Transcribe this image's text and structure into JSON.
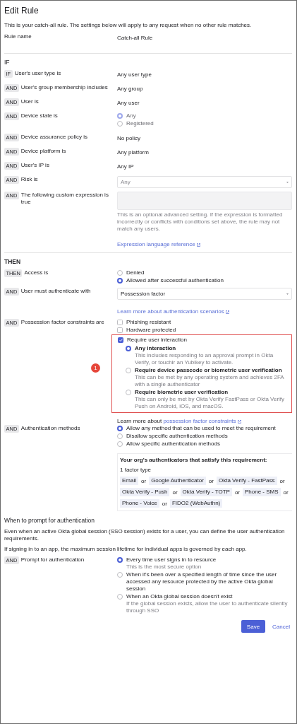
{
  "title": "Edit Rule",
  "intro": "This is your catch-all rule. The settings below will apply to any request when no other rule matches.",
  "rule_name": {
    "label": "Rule name",
    "value": "Catch-all Rule"
  },
  "if_section": {
    "heading": "IF",
    "rows": [
      {
        "badge": "IF",
        "label": "User's user type is",
        "kind": "text",
        "value": "Any user type"
      },
      {
        "badge": "AND",
        "label": "User's group membership includes",
        "kind": "text",
        "value": "Any group"
      },
      {
        "badge": "AND",
        "label": "User is",
        "kind": "text",
        "value": "Any user"
      },
      {
        "badge": "AND",
        "label": "Device state is",
        "kind": "radios",
        "disabled": true,
        "options": [
          {
            "label": "Any",
            "selected": true
          },
          {
            "label": "Registered",
            "selected": false
          }
        ]
      },
      {
        "badge": "AND",
        "label": "Device assurance policy is",
        "kind": "text",
        "value": "No policy"
      },
      {
        "badge": "AND",
        "label": "Device platform is",
        "kind": "text",
        "value": "Any platform"
      },
      {
        "badge": "AND",
        "label": "User's IP is",
        "kind": "text",
        "value": "Any IP"
      },
      {
        "badge": "AND",
        "label": "Risk is",
        "kind": "select",
        "disabled": true,
        "value": "Any"
      },
      {
        "badge": "AND",
        "label": "The following custom expression is true",
        "kind": "textarea",
        "disabled": true,
        "help": "This is an optional advanced setting. If the expression is formatted incorrectly or conflicts with conditions set above, the rule may not match any users.",
        "link": "Expression language reference"
      }
    ]
  },
  "then_section": {
    "heading": "THEN",
    "rows": [
      {
        "badge": "THEN",
        "label": "Access is",
        "kind": "radios",
        "options": [
          {
            "label": "Denied",
            "selected": false
          },
          {
            "label": "Allowed after successful authentication",
            "selected": true
          }
        ]
      },
      {
        "badge": "AND",
        "label": "User must authenticate with",
        "kind": "select",
        "disabled": false,
        "value": "Possession factor",
        "link": "Learn more about authentication scenarios"
      },
      {
        "badge": "AND",
        "label": "Possession factor constraints are",
        "kind": "constraints",
        "callout": "1",
        "checks": [
          {
            "label": "Phishing resistant",
            "checked": false,
            "highlighted": false
          },
          {
            "label": "Hardware protected",
            "checked": false,
            "highlighted": false
          },
          {
            "label": "Require user interaction",
            "checked": true,
            "highlighted": true,
            "options": [
              {
                "label": "Any interaction",
                "description": "This includes responding to an approval prompt in Okta Verify, or touchir an Yubikey to activate.",
                "selected": true
              },
              {
                "label": "Require device passcode or biometric user verification",
                "description": "This can be met by any operating system and achieves 2FA with a single authenticator",
                "selected": false
              },
              {
                "label": "Require biometric user verification",
                "description": "This can only be met by Okta Verify FastPass or Okta Verify Push on Android, iOS, and macOS.",
                "selected": false
              }
            ]
          }
        ],
        "footer_prefix": "Learn more about",
        "footer_link": "possession factor constraints"
      },
      {
        "badge": "AND",
        "label": "Authentication methods",
        "kind": "radios",
        "options": [
          {
            "label": "Allow any method that can be used to meet the requirement",
            "selected": true
          },
          {
            "label": "Disallow specific authentication methods",
            "selected": false
          },
          {
            "label": "Allow specific authentication methods",
            "selected": false
          }
        ],
        "authenticators": {
          "title": "Your org's authenticators that satisfy this requirement:",
          "subtitle": "1 factor type",
          "items": [
            {
              "kind": "chip",
              "text": "Email"
            },
            {
              "kind": "word",
              "text": "or"
            },
            {
              "kind": "chip",
              "text": "Google Authenticator"
            },
            {
              "kind": "word",
              "text": "or"
            },
            {
              "kind": "chip",
              "text": "Okta Verify - FastPass"
            },
            {
              "kind": "word",
              "text": "or"
            },
            {
              "kind": "chip",
              "text": "Okta Verify - Push"
            },
            {
              "kind": "word",
              "text": "or"
            },
            {
              "kind": "chip",
              "text": "Okta Verify - TOTP"
            },
            {
              "kind": "word",
              "text": "or"
            },
            {
              "kind": "chip",
              "text": "Phone - SMS"
            },
            {
              "kind": "word",
              "text": "or"
            },
            {
              "kind": "chip",
              "text": "Phone - Voice"
            },
            {
              "kind": "word",
              "text": "or"
            },
            {
              "kind": "chip",
              "text": "FIDO2 (WebAuthn)"
            }
          ]
        }
      }
    ]
  },
  "prompt_section": {
    "heading": "When to prompt for authentication",
    "paragraphs": [
      "Even when an active Okta global session (SSO session) exists for a user, you can define the user authentication requirements.",
      "If signing in to an app, the maximum session lifetime for individual apps is governed by each app."
    ],
    "rows": [
      {
        "badge": "AND",
        "label": "Prompt for authentication",
        "kind": "radios",
        "options": [
          {
            "label": "Every time user signs in to resource",
            "description": "This is the most secure option",
            "selected": true
          },
          {
            "label": "When it's been over a specified length of time since the user accessed any resource protected by the active Okta global session",
            "selected": false
          },
          {
            "label": "When an Okta global session doesn't exist",
            "description": "If the global session exists, allow the user to authenticate silently through SSO",
            "selected": false
          }
        ]
      }
    ]
  },
  "buttons": [
    {
      "label": "Save",
      "kind": "primary"
    },
    {
      "label": "Cancel",
      "kind": "link"
    }
  ]
}
